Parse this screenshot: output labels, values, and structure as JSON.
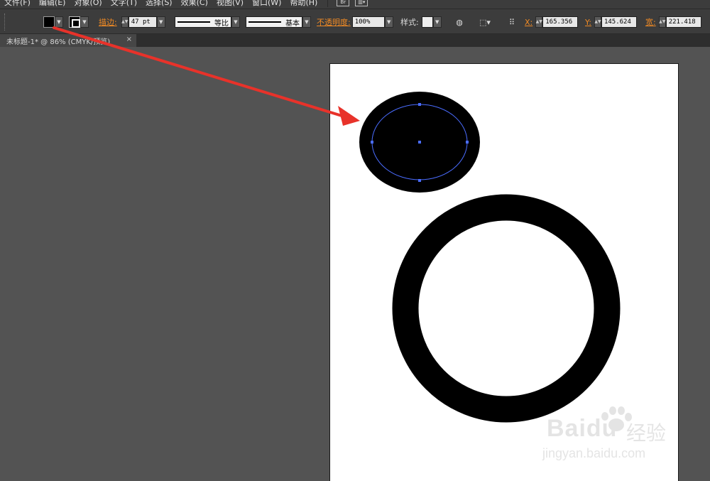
{
  "menu": {
    "items": [
      "文件(F)",
      "编辑(E)",
      "对象(O)",
      "文字(T)",
      "选择(S)",
      "效果(C)",
      "视图(V)",
      "窗口(W)",
      "帮助(H)"
    ],
    "bridge_label": "Br"
  },
  "control": {
    "fill_color": "#000000",
    "stroke_label": "描边:",
    "stroke_weight": "47 pt",
    "profile_label": "等比",
    "brush_label": "基本",
    "opacity_label": "不透明度:",
    "opacity_value": "100%",
    "style_label": "样式:",
    "x_label": "X:",
    "x_value": "165.356",
    "y_label": "Y:",
    "y_value": "145.624",
    "w_label": "宽:",
    "w_value": "221.418"
  },
  "tab": {
    "title": "未标题-1* @ 86% (CMYK/预览)",
    "close": "×"
  },
  "colors": {
    "accent_orange": "#f08a24",
    "arrow_red": "#e8322a",
    "selection_blue": "#4a6cff",
    "workspace": "#535353"
  },
  "watermark": {
    "logo": "Baidu",
    "cn": "经验",
    "url": "jingyan.baidu.com"
  }
}
